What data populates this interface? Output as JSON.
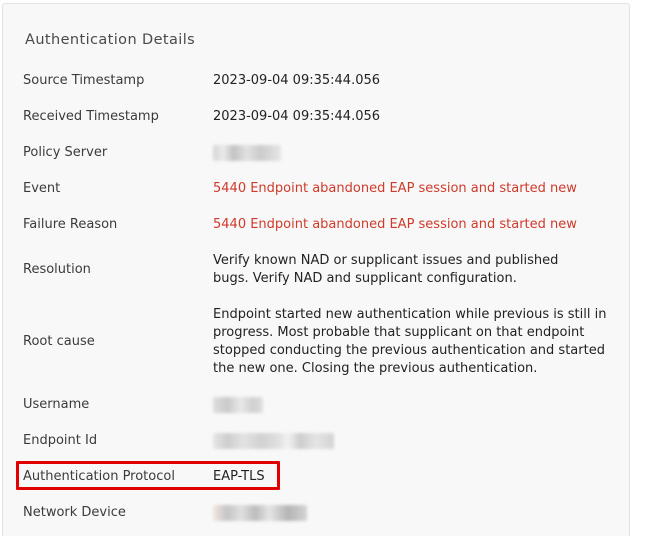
{
  "panel": {
    "title": "Authentication Details"
  },
  "rows": {
    "source_timestamp": {
      "label": "Source Timestamp",
      "value": "2023-09-04 09:35:44.056"
    },
    "received_timestamp": {
      "label": "Received Timestamp",
      "value": "2023-09-04 09:35:44.056"
    },
    "policy_server": {
      "label": "Policy Server"
    },
    "event": {
      "label": "Event",
      "value": "5440 Endpoint abandoned EAP session and started new"
    },
    "failure_reason": {
      "label": "Failure Reason",
      "value": "5440 Endpoint abandoned EAP session and started new"
    },
    "resolution": {
      "label": "Resolution",
      "value": "Verify known NAD or supplicant issues and published bugs. Verify NAD and supplicant configuration."
    },
    "root_cause": {
      "label": "Root cause",
      "value": "Endpoint started new authentication while previous is still in progress. Most probable that supplicant on that endpoint stopped conducting the previous authentication and started the new one. Closing the previous authentication."
    },
    "username": {
      "label": "Username"
    },
    "endpoint_id": {
      "label": "Endpoint Id"
    },
    "authentication_protocol": {
      "label": "Authentication Protocol",
      "value": "EAP-TLS"
    },
    "network_device": {
      "label": "Network Device"
    }
  },
  "colors": {
    "error_text": "#cf3a2b",
    "highlight_box": "#e00000",
    "panel_background": "#f8f8f8"
  }
}
